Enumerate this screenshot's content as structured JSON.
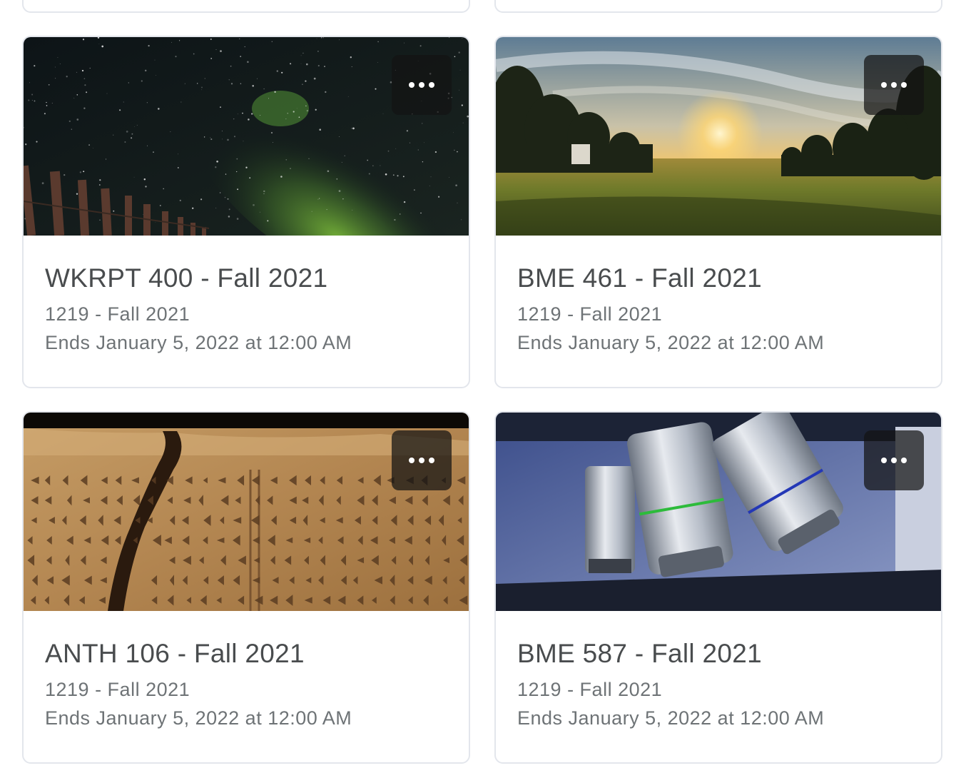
{
  "courses": [
    {
      "title": "WKRPT 400 - Fall 2021",
      "semester": "1219 - Fall 2021",
      "ends": "Ends January 5, 2022 at 12:00 AM",
      "image": "night-sky-milky-way"
    },
    {
      "title": "BME 461 - Fall 2021",
      "semester": "1219 - Fall 2021",
      "ends": "Ends January 5, 2022 at 12:00 AM",
      "image": "sunrise-field"
    },
    {
      "title": "ANTH 106 - Fall 2021",
      "semester": "1219 - Fall 2021",
      "ends": "Ends January 5, 2022 at 12:00 AM",
      "image": "cuneiform-tablet"
    },
    {
      "title": "BME 587 - Fall 2021",
      "semester": "1219 - Fall 2021",
      "ends": "Ends January 5, 2022 at 12:00 AM",
      "image": "microscope-objectives"
    }
  ],
  "menu_icon": "more-horizontal-icon",
  "colors": {
    "card_border": "#e3e6ec",
    "title_text": "#494c4e",
    "meta_text": "#6e7376",
    "menu_bg": "#141414"
  }
}
